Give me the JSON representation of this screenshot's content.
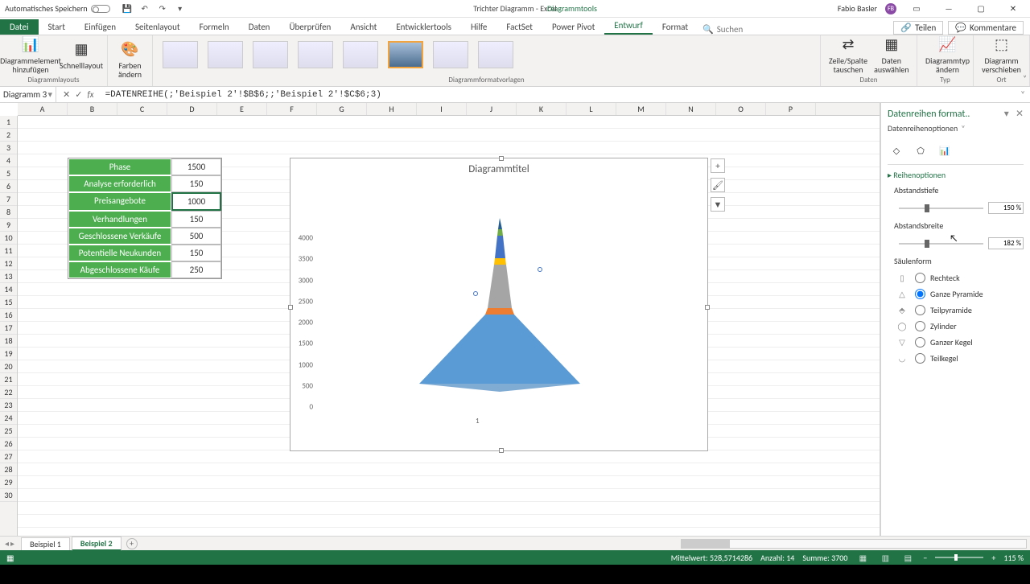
{
  "titlebar": {
    "autosave_label": "Automatisches Speichern",
    "doc_title": "Trichter Diagramm - Excel",
    "tool_title": "Diagrammtools",
    "user_name": "Fabio Basler",
    "user_initials": "FB"
  },
  "ribbon_tabs": {
    "file": "Datei",
    "items": [
      "Start",
      "Einfügen",
      "Seitenlayout",
      "Formeln",
      "Daten",
      "Überprüfen",
      "Ansicht",
      "Entwicklertools",
      "Hilfe",
      "FactSet",
      "Power Pivot",
      "Entwurf",
      "Format"
    ],
    "active": "Entwurf",
    "search_placeholder": "Suchen",
    "share": "Teilen",
    "comments": "Kommentare"
  },
  "ribbon_groups": {
    "layouts_label": "Diagrammlayouts",
    "add_element": "Diagrammelement hinzufügen",
    "quick_layout": "Schnelllayout",
    "colors": "Farben ändern",
    "styles_label": "Diagrammformatvorlagen",
    "data_label": "Daten",
    "switch_rowcol": "Zeile/Spalte tauschen",
    "select_data": "Daten auswählen",
    "type_label": "Typ",
    "change_type": "Diagrammtyp ändern",
    "location_label": "Ort",
    "move_chart": "Diagramm verschieben"
  },
  "namebox": "Diagramm 3",
  "formula": "=DATENREIHE(;'Beispiel 2'!$B$6;;'Beispiel 2'!$C$6;3)",
  "columns": [
    "A",
    "B",
    "C",
    "D",
    "E",
    "F",
    "G",
    "H",
    "I",
    "J",
    "K",
    "L",
    "M",
    "N",
    "O",
    "P"
  ],
  "row_count": 30,
  "table": {
    "rows": [
      {
        "label": "Phase",
        "value": "1500"
      },
      {
        "label": "Analyse erforderlich",
        "value": "150"
      },
      {
        "label": "Preisangebote",
        "value": "1000"
      },
      {
        "label": "Verhandlungen",
        "value": "150"
      },
      {
        "label": "Geschlossene Verkäufe",
        "value": "500"
      },
      {
        "label": "Potentielle Neukunden",
        "value": "150"
      },
      {
        "label": "Abgeschlossene Käufe",
        "value": "250"
      }
    ],
    "selected_row_index": 2
  },
  "chart": {
    "title": "Diagrammtitel",
    "y_ticks": [
      "0",
      "500",
      "1000",
      "1500",
      "2000",
      "2500",
      "3000",
      "3500",
      "4000"
    ],
    "x_tick": "1"
  },
  "format_pane": {
    "title": "Datenreihen format..",
    "dropdown": "Datenreihenoptionen",
    "section": "Reihenoptionen",
    "gap_depth_label": "Abstandstiefe",
    "gap_depth_value": "150 %",
    "gap_width_label": "Abstandsbreite",
    "gap_width_value": "182 %",
    "shape_label": "Säulenform",
    "shapes": [
      "Rechteck",
      "Ganze Pyramide",
      "Teilpyramide",
      "Zylinder",
      "Ganzer Kegel",
      "Teilkegel"
    ],
    "selected_shape": "Ganze Pyramide"
  },
  "sheets": {
    "tabs": [
      "Beispiel 1",
      "Beispiel 2"
    ],
    "active": "Beispiel 2"
  },
  "status": {
    "mean_label": "Mittelwert:",
    "mean_value": "528,5714286",
    "count_label": "Anzahl:",
    "count_value": "14",
    "sum_label": "Summe:",
    "sum_value": "3700",
    "zoom": "115 %"
  },
  "chart_data": {
    "type": "bar",
    "title": "Diagrammtitel",
    "categories": [
      "1"
    ],
    "series": [
      {
        "name": "Phase",
        "values": [
          1500
        ],
        "color": "#5b9bd5"
      },
      {
        "name": "Analyse erforderlich",
        "values": [
          150
        ],
        "color": "#ed7d31"
      },
      {
        "name": "Preisangebote",
        "values": [
          1000
        ],
        "color": "#a5a5a5"
      },
      {
        "name": "Verhandlungen",
        "values": [
          150
        ],
        "color": "#ffc000"
      },
      {
        "name": "Geschlossene Verkäufe",
        "values": [
          500
        ],
        "color": "#4472c4"
      },
      {
        "name": "Potentielle Neukunden",
        "values": [
          150
        ],
        "color": "#70ad47"
      },
      {
        "name": "Abgeschlossene Käufe",
        "values": [
          250
        ],
        "color": "#255e91"
      }
    ],
    "xlabel": "",
    "ylabel": "",
    "ylim": [
      0,
      4000
    ],
    "stacked": true,
    "shape": "full_pyramid"
  }
}
